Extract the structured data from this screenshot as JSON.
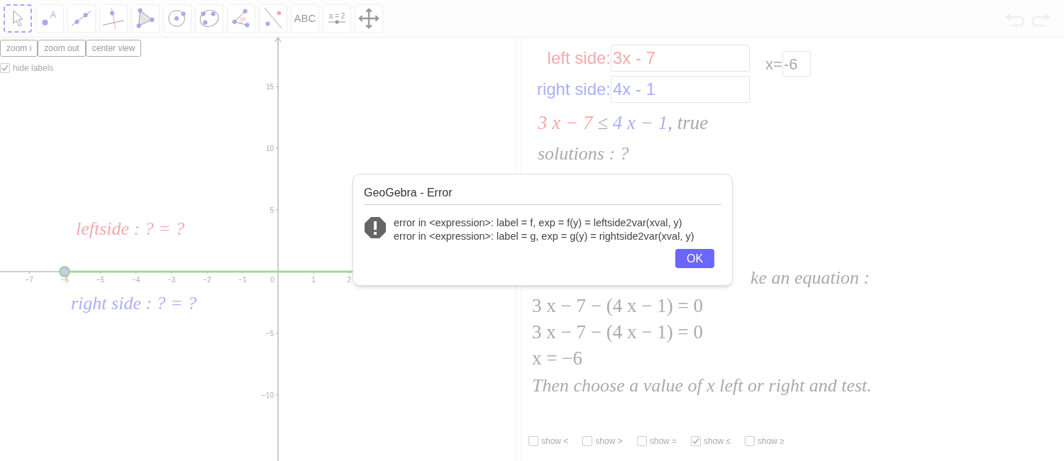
{
  "toolbar": {
    "tools": [
      {
        "kind": "move",
        "selected": true
      },
      {
        "kind": "point",
        "selected": false,
        "label": "A"
      },
      {
        "kind": "line",
        "selected": false
      },
      {
        "kind": "perpendicular",
        "selected": false
      },
      {
        "kind": "polygon",
        "selected": false
      },
      {
        "kind": "circle",
        "selected": false
      },
      {
        "kind": "conic",
        "selected": false
      },
      {
        "kind": "angle",
        "selected": false
      },
      {
        "kind": "reflect",
        "selected": false
      },
      {
        "kind": "text",
        "selected": false,
        "label": "ABC"
      },
      {
        "kind": "slider",
        "selected": false,
        "label": "a = 2"
      },
      {
        "kind": "move-view",
        "selected": false
      }
    ]
  },
  "graphics": {
    "buttons": [
      "zoom i",
      "zoom out",
      "center view"
    ],
    "hide_labels": {
      "label": "hide labels",
      "checked": true
    },
    "x_ticks": [
      "−7",
      "−6",
      "−5",
      "−4",
      "−3",
      "−2",
      "−1",
      "0",
      "1",
      "2"
    ],
    "y_ticks": [
      "15",
      "10",
      "5",
      "−5",
      "−10"
    ],
    "left_label": "leftside : ? = ?",
    "right_label": "right side : ? = ?"
  },
  "algebra": {
    "left_side": {
      "label": "left side:",
      "value": "3x - 7"
    },
    "right_side": {
      "label": "right side:",
      "value": "4x - 1"
    },
    "x_field": {
      "label": "x=",
      "value": "-6"
    },
    "inequality": [
      {
        "text": "3 x − 7 ",
        "kind": "left"
      },
      {
        "text": "≤ ",
        "kind": "plain"
      },
      {
        "text": "4 x − 1",
        "kind": "right"
      },
      {
        "text": ", true",
        "kind": "plain"
      }
    ],
    "solutions": "solutions : ?",
    "hint_tail": "ke an equation :",
    "steps": [
      "3 x − 7 − (4 x − 1) = 0",
      "3 x − 7 − (4 x − 1) = 0",
      "x = −6"
    ],
    "closing": "Then choose a value of x left or right and test.",
    "checkboxes": [
      {
        "label": "show <",
        "checked": false
      },
      {
        "label": "show >",
        "checked": false
      },
      {
        "label": "show =",
        "checked": false
      },
      {
        "label": "show ≤",
        "checked": true
      },
      {
        "label": "show ≥",
        "checked": false
      }
    ]
  },
  "dialog": {
    "title": "GeoGebra - Error",
    "lines": [
      "error in <expression>: label = f, exp = f(y) = leftside2var(xval, y)",
      "error in <expression>: label = g, exp = g(y) = rightside2var(xval, y)"
    ],
    "button": "OK"
  }
}
